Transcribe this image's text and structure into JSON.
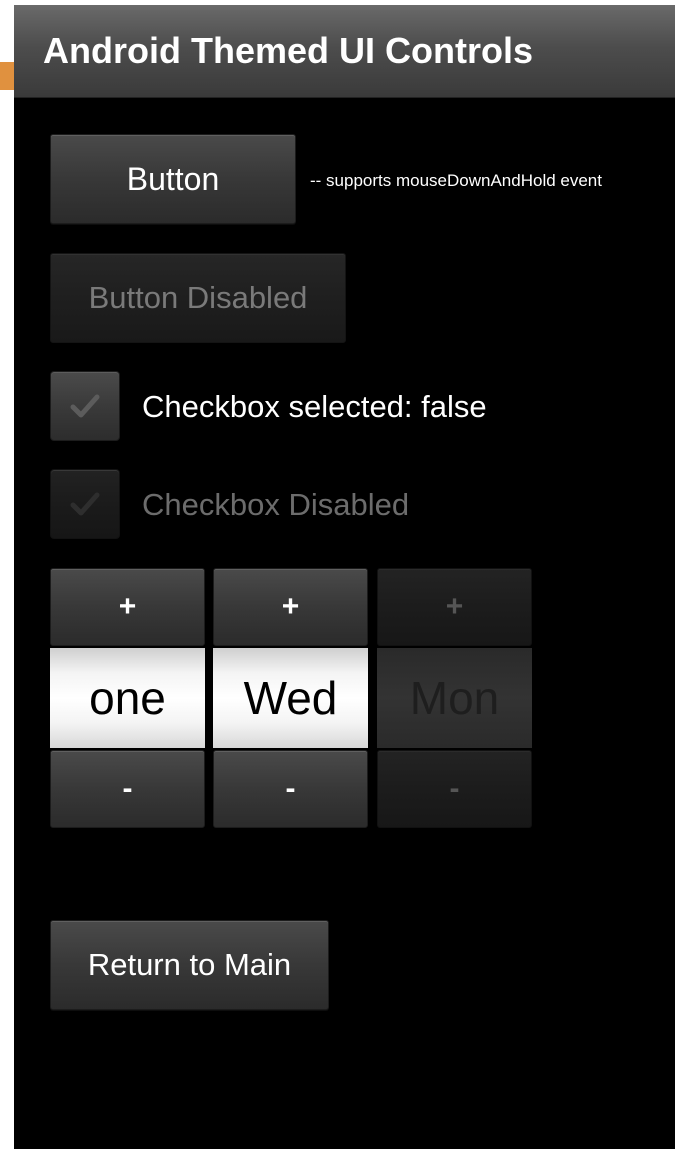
{
  "header": {
    "title": "Android Themed UI Controls"
  },
  "button": {
    "label": "Button",
    "note": "-- supports mouseDownAndHold event"
  },
  "button_disabled": {
    "label": "Button Disabled"
  },
  "checkbox": {
    "label": "Checkbox selected: false",
    "checked": false
  },
  "checkbox_disabled": {
    "label": "Checkbox Disabled"
  },
  "spinners": [
    {
      "plus": "+",
      "value": "one",
      "minus": "-",
      "disabled": false
    },
    {
      "plus": "+",
      "value": "Wed",
      "minus": "-",
      "disabled": false
    },
    {
      "plus": "+",
      "value": "Mon",
      "minus": "-",
      "disabled": true
    }
  ],
  "return_button": {
    "label": "Return to Main"
  },
  "colors": {
    "background": "#000000",
    "header": "#4d4d4d",
    "accent": "#e0913f",
    "disabled_text": "#6c6c6c"
  },
  "icons": {
    "checkmark": "checkmark-icon"
  }
}
